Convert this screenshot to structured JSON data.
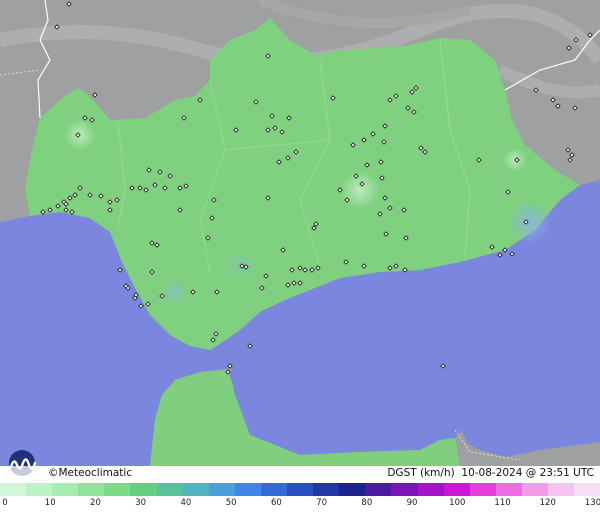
{
  "branding": {
    "copyright": "©",
    "name": "Meteoclimatic"
  },
  "product": {
    "variable": "DGST",
    "unit": "(km/h)",
    "datetime": "10-08-2024 @ 23:51 UTC"
  },
  "legend": {
    "ticks": [
      "0",
      "10",
      "20",
      "30",
      "40",
      "50",
      "60",
      "70",
      "80",
      "90",
      "100",
      "110",
      "120",
      "130"
    ],
    "colors": [
      "#d4f7dc",
      "#bdf2c7",
      "#a6ecb2",
      "#8fe49d",
      "#78dc8a",
      "#63cf82",
      "#58c29a",
      "#4fb3c0",
      "#4aa0de",
      "#3f86ea",
      "#3568d8",
      "#2a4dbf",
      "#2336a6",
      "#1d238f",
      "#4a1aa0",
      "#7b15b5",
      "#a514c8",
      "#cc18d6",
      "#e43fdd",
      "#ee6de4",
      "#f39ae9",
      "#f6c2ee",
      "#f9dff4"
    ]
  },
  "colors": {
    "sea": "#7b87de",
    "land_outside": "#9ea0a2",
    "andalusia": "#7fd07f",
    "morocco": "#7fcf7e"
  }
}
